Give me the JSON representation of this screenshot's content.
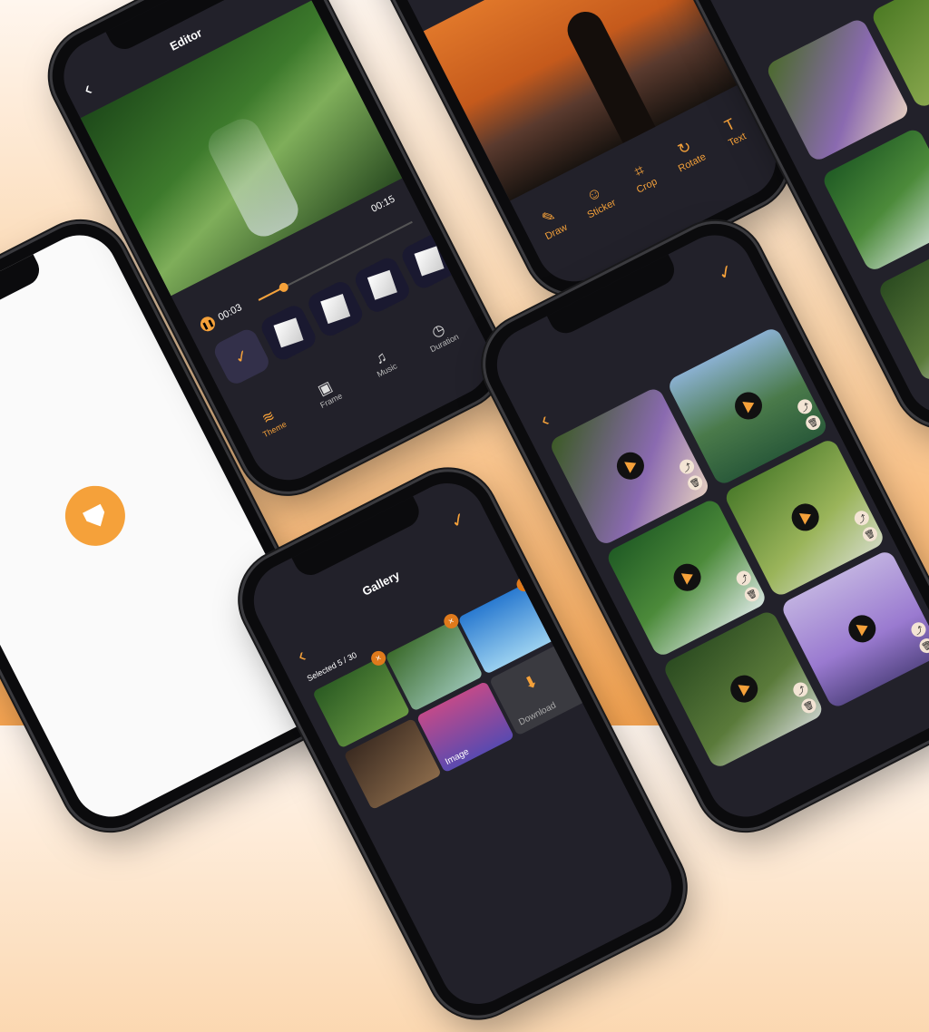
{
  "colors": {
    "accent": "#f5a13a",
    "screen_bg": "#22212a",
    "background_bottom": "#f6a451"
  },
  "editor": {
    "title": "Editor",
    "back_icon": "chevron-left-icon",
    "time_current": "00:03",
    "time_total": "00:15",
    "nav": [
      {
        "label": "Theme",
        "icon": "layers-icon"
      },
      {
        "label": "Frame",
        "icon": "frame-icon"
      },
      {
        "label": "Music",
        "icon": "music-icon"
      },
      {
        "label": "Duration",
        "icon": "clock-icon"
      }
    ]
  },
  "photo_tools": {
    "tools": [
      {
        "label": "Draw",
        "icon": "brush-icon"
      },
      {
        "label": "Sticker",
        "icon": "sticker-icon"
      },
      {
        "label": "Crop",
        "icon": "crop-icon"
      },
      {
        "label": "Rotate",
        "icon": "rotate-icon"
      },
      {
        "label": "Text",
        "icon": "text-icon"
      }
    ]
  },
  "gallery": {
    "title": "Gallery",
    "selected": "Selected 5 / 30",
    "image_label": "Image",
    "download_label": "Download"
  },
  "splash": {
    "logo_icon": "app-logo-icon"
  },
  "videos": {
    "back_icon": "chevron-left-icon",
    "check_icon": "check-icon"
  }
}
